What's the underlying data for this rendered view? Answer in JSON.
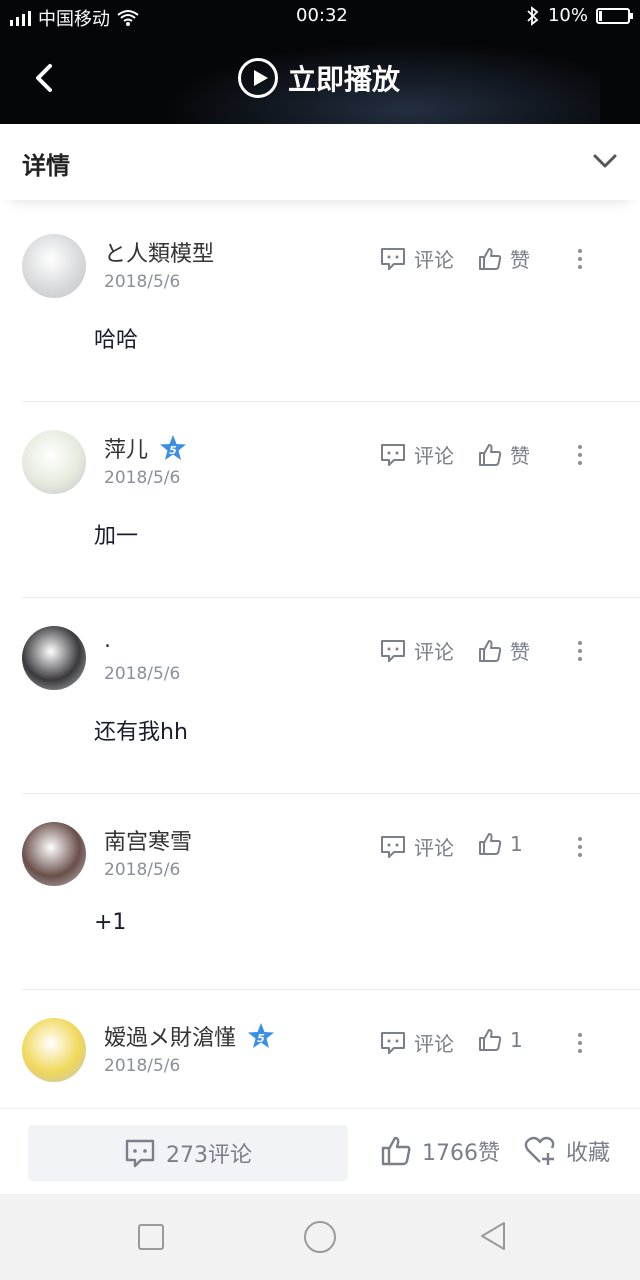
{
  "status_bar": {
    "carrier": "中国移动",
    "time": "00:32",
    "battery": "10%",
    "battery_level": 0.1,
    "icons": [
      "signal-icon",
      "wifi-icon",
      "bluetooth-icon",
      "battery-icon"
    ]
  },
  "header": {
    "play_label": "立即播放",
    "icons": [
      "back-icon",
      "play-icon"
    ]
  },
  "details": {
    "title": "详情",
    "icon": "chevron-down-icon"
  },
  "comments": [
    {
      "username": "と人類模型",
      "vip": false,
      "date": "2018/5/6",
      "text": "哈哈",
      "comment_label": "评论",
      "like_label": "赞",
      "avatar_color": "#d9dadc"
    },
    {
      "username": "萍儿",
      "vip": true,
      "date": "2018/5/6",
      "text": "加一",
      "comment_label": "评论",
      "like_label": "赞",
      "avatar_color": "#e6eadd"
    },
    {
      "username": ".",
      "vip": false,
      "date": "2018/5/6",
      "text": "还有我hh",
      "comment_label": "评论",
      "like_label": "赞",
      "avatar_color": "#3a3a3e"
    },
    {
      "username": "南宫寒雪",
      "vip": false,
      "date": "2018/5/6",
      "text": "+1",
      "comment_label": "评论",
      "like_label": "1",
      "avatar_color": "#6a4f4a"
    },
    {
      "username": "嫒過メ財滄慬",
      "vip": true,
      "date": "2018/5/6",
      "text": "",
      "comment_label": "评论",
      "like_label": "1",
      "avatar_color": "#f0d85a"
    }
  ],
  "bottom_bar": {
    "comments": "273评论",
    "likes": "1766赞",
    "favorite": "收藏"
  },
  "colors": {
    "header_bg": "#050608",
    "vip_badge": "#3a8ee6",
    "secondary_text": "#7a7f89"
  }
}
